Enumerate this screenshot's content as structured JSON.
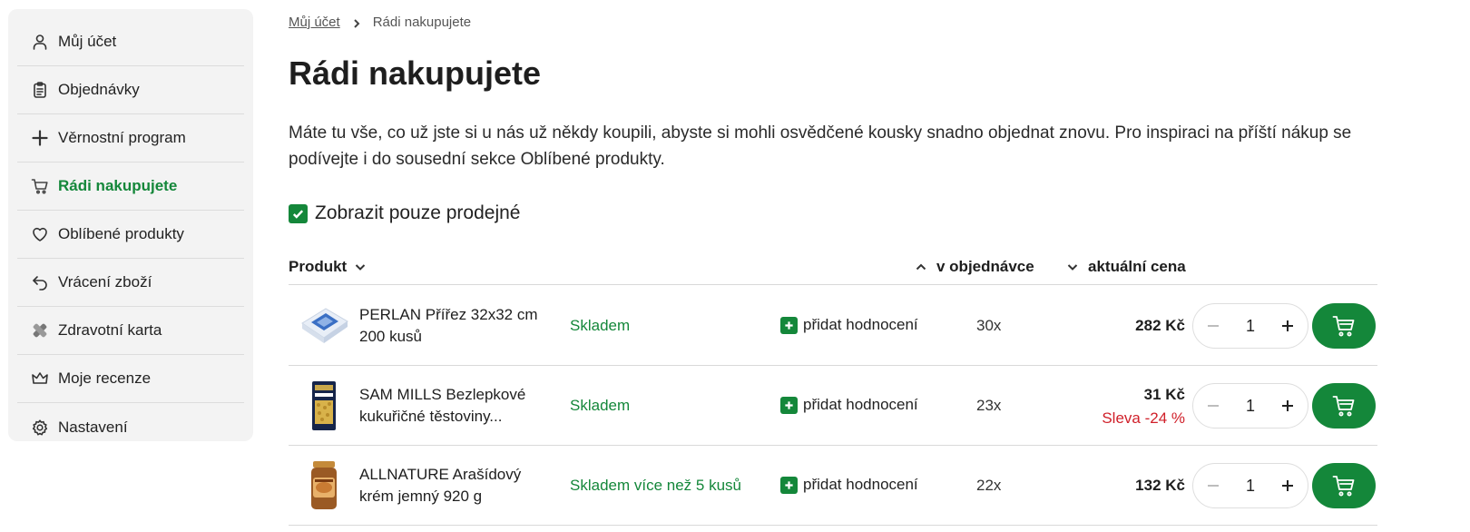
{
  "sidebar": {
    "items": [
      {
        "label": "Můj účet",
        "icon": "user-icon"
      },
      {
        "label": "Objednávky",
        "icon": "clipboard-icon"
      },
      {
        "label": "Věrnostní program",
        "icon": "plus-icon"
      },
      {
        "label": "Rádi nakupujete",
        "icon": "cart-icon"
      },
      {
        "label": "Oblíbené produkty",
        "icon": "heart-icon"
      },
      {
        "label": "Vrácení zboží",
        "icon": "return-icon"
      },
      {
        "label": "Zdravotní karta",
        "icon": "health-card-icon"
      },
      {
        "label": "Moje recenze",
        "icon": "crown-icon"
      },
      {
        "label": "Nastavení",
        "icon": "gear-icon"
      }
    ],
    "active_index": 3
  },
  "breadcrumb": {
    "home": "Můj účet",
    "current": "Rádi nakupujete"
  },
  "page": {
    "title": "Rádi nakupujete",
    "intro": "Máte tu vše, co už jste si u nás už někdy koupili, abyste si mohli osvědčené kousky snadno objednat znovu. Pro inspiraci na příští nákup se podívejte i do sousední sekce Oblíbené produkty."
  },
  "filter": {
    "label": "Zobrazit pouze prodejné",
    "checked": true
  },
  "table": {
    "headers": {
      "product": "Produkt",
      "orders": "v objednávce",
      "price": "aktuální cena"
    },
    "rows": [
      {
        "name": "PERLAN Přířez 32x32 cm 200 kusů",
        "stock": "Skladem",
        "rate_label": "přidat hodnocení",
        "count": "30x",
        "price": "282 Kč",
        "discount": "",
        "qty": "1"
      },
      {
        "name": "SAM MILLS Bezlepkové kukuřičné těstoviny...",
        "stock": "Skladem",
        "rate_label": "přidat hodnocení",
        "count": "23x",
        "price": "31 Kč",
        "discount": "Sleva -24 %",
        "qty": "1"
      },
      {
        "name": "ALLNATURE Arašídový krém jemný 920 g",
        "stock": "Skladem více než 5 kusů",
        "rate_label": "přidat hodnocení",
        "count": "22x",
        "price": "132 Kč",
        "discount": "",
        "qty": "1"
      }
    ]
  },
  "colors": {
    "accent": "#14873a",
    "discount": "#d0202a",
    "sidebar_bg": "#f3f3f3"
  }
}
